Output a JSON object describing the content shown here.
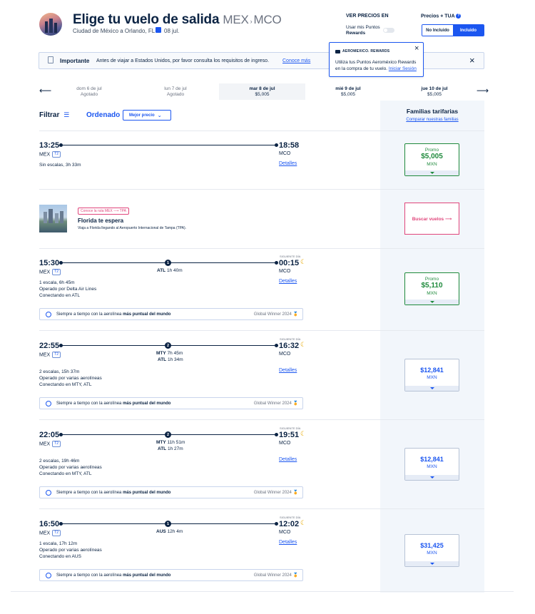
{
  "header": {
    "title": "Elige tu vuelo de salida",
    "origin": "MEX",
    "destination": "MCO",
    "subtitle": "Ciudad de México a Orlando, FL",
    "date": "08 jul."
  },
  "prices_toggle": {
    "title": "VER PRECIOS EN",
    "points_line1": "Usar mis Puntos",
    "points_line2": "Rewards"
  },
  "tua": {
    "title": "Precios + TUA",
    "not_included": "No Incluido",
    "included": "Incluido"
  },
  "important": {
    "label": "Importante",
    "text": "Antes de viajar a Estados Unidos, por favor consulta los requisitos de ingreso.",
    "link": "Conoce más"
  },
  "rewards_pop": {
    "brand": "AEROMEXICO. REWARDS",
    "text1": "Utiliza tus Puntos Aeroméxico Rewards",
    "text2": "en la compra de tu vuelo.",
    "link": "Iniciar Sesión"
  },
  "dates": [
    {
      "day": "dom 6 de jul",
      "status": "Agotado"
    },
    {
      "day": "lun 7 de jul",
      "status": "Agotado"
    },
    {
      "day": "mar 8 de jul",
      "status": "$5,005"
    },
    {
      "day": "mié 9 de jul",
      "status": "$5,005"
    },
    {
      "day": "jue 10 de jul",
      "status": "$5,005"
    }
  ],
  "filters": {
    "filter": "Filtrar",
    "sorted": "Ordenado",
    "sort_value": "Mejor precio"
  },
  "families": {
    "title": "Familias tarifarias",
    "link": "Comparar nuestras familias"
  },
  "promo": {
    "tag": "Conoce la ruta MEX ⟶ TPA",
    "title": "Florida te espera",
    "text": "Viaja a Florida llegando al Aeropuerto Internacional de Tampa (TPA).",
    "button": "Buscar vuelos ⟶"
  },
  "common": {
    "terminal": "T2",
    "details": "Detalles",
    "next_day": "SIGUIENTE DÍA",
    "currency": "MXN",
    "promo_label": "Promo",
    "on_time_pre": "Siempre a tiempo con la aerolínea",
    "on_time_bold": "más puntual del mundo",
    "winner": "Global Winner 2024"
  },
  "flights": [
    {
      "dep": "13:25",
      "arr": "18:58",
      "from": "MEX",
      "to": "MCO",
      "duration": "Sin escalas, 3h 33m",
      "operated": "",
      "connecting": "",
      "price": "$5,005",
      "promo": true
    },
    {
      "dep": "15:30",
      "arr": "00:15",
      "from": "MEX",
      "to": "MCO",
      "stops": "1",
      "stop1": "ATL",
      "stop1_time": "1h 40m",
      "duration": "1 escala, 6h 45m",
      "operated": "Operado por Delta Air Lines",
      "connecting": "Conectando en ATL",
      "price": "$5,110",
      "promo": true
    },
    {
      "dep": "22:55",
      "arr": "16:32",
      "from": "MEX",
      "to": "MCO",
      "stops": "2",
      "stop1": "MTY",
      "stop1_time": "7h 45m",
      "stop2": "ATL",
      "stop2_time": "1h 34m",
      "duration": "2 escalas, 15h 37m",
      "operated": "Operado por varias aerolíneas",
      "connecting": "Conectando en MTY, ATL",
      "price": "$12,841",
      "promo": false
    },
    {
      "dep": "22:05",
      "arr": "19:51",
      "from": "MEX",
      "to": "MCO",
      "stops": "2",
      "stop1": "MTY",
      "stop1_time": "11h 51m",
      "stop2": "ATL",
      "stop2_time": "1h 27m",
      "duration": "2 escalas, 19h 46m",
      "operated": "Operado por varias aerolíneas",
      "connecting": "Conectando en MTY, ATL",
      "price": "$12,841",
      "promo": false
    },
    {
      "dep": "16:50",
      "arr": "12:02",
      "from": "MEX",
      "to": "MCO",
      "stops": "1",
      "stop1": "AUS",
      "stop1_time": "12h 4m",
      "duration": "1 escala, 17h 12m",
      "operated": "Operado por varias aerolíneas",
      "connecting": "Conectando en AUS",
      "price": "$31,425",
      "promo": false
    }
  ]
}
